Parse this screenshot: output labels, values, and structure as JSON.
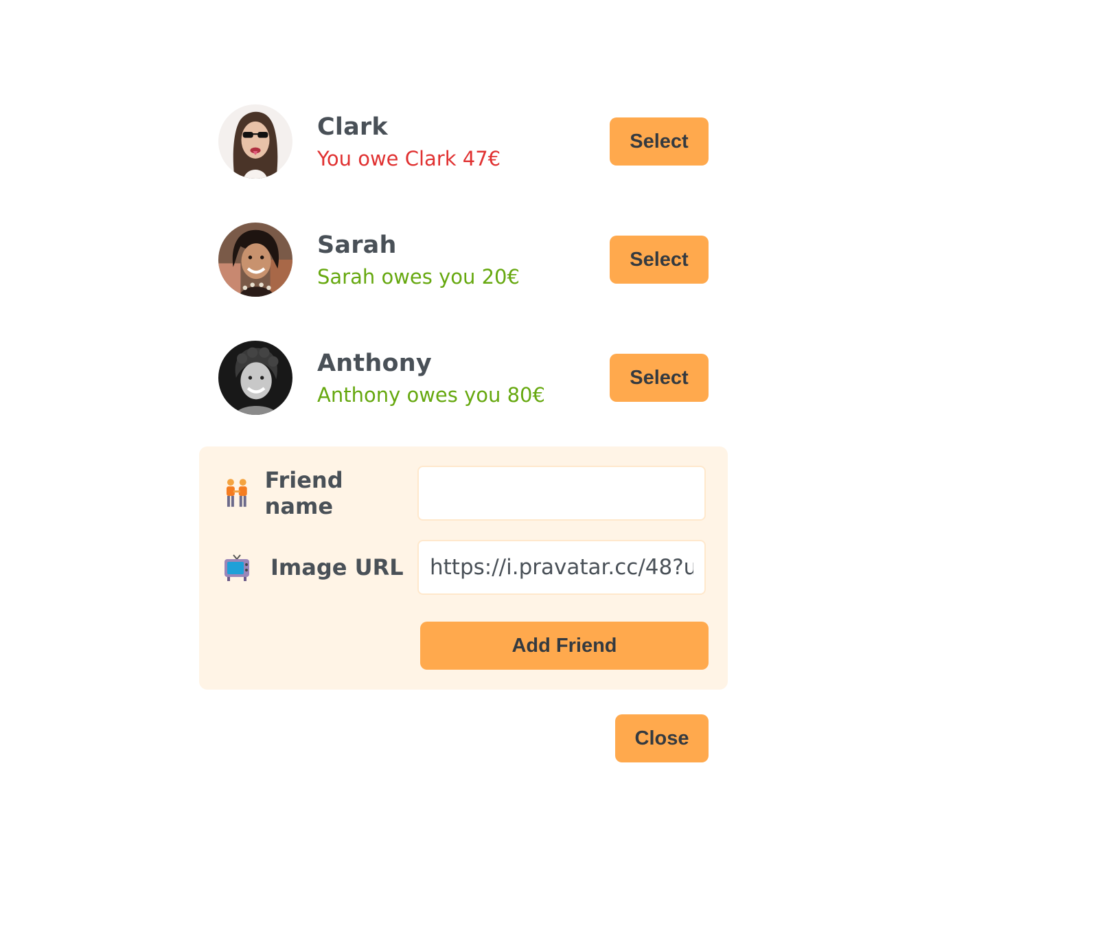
{
  "friends": [
    {
      "name": "Clark",
      "balance_text": "You owe Clark 47€",
      "balance_status": "owe",
      "avatar": "clark-avatar",
      "select_label": "Select"
    },
    {
      "name": "Sarah",
      "balance_text": "Sarah owes you 20€",
      "balance_status": "owed",
      "avatar": "sarah-avatar",
      "select_label": "Select"
    },
    {
      "name": "Anthony",
      "balance_text": "Anthony owes you 80€",
      "balance_status": "owed",
      "avatar": "anthony-avatar",
      "select_label": "Select"
    }
  ],
  "add_form": {
    "name_icon": "people-holding-hands-icon",
    "name_label": "Friend name",
    "name_value": "",
    "image_icon": "television-icon",
    "image_label": "Image URL",
    "image_value": "https://i.pravatar.cc/48?u=",
    "submit_label": "Add Friend"
  },
  "close_label": "Close",
  "colors": {
    "accent": "#ffa94d",
    "form_background": "#fff4e6",
    "owe_red": "#e03131",
    "owed_green": "#66a80f",
    "text": "#495057"
  }
}
